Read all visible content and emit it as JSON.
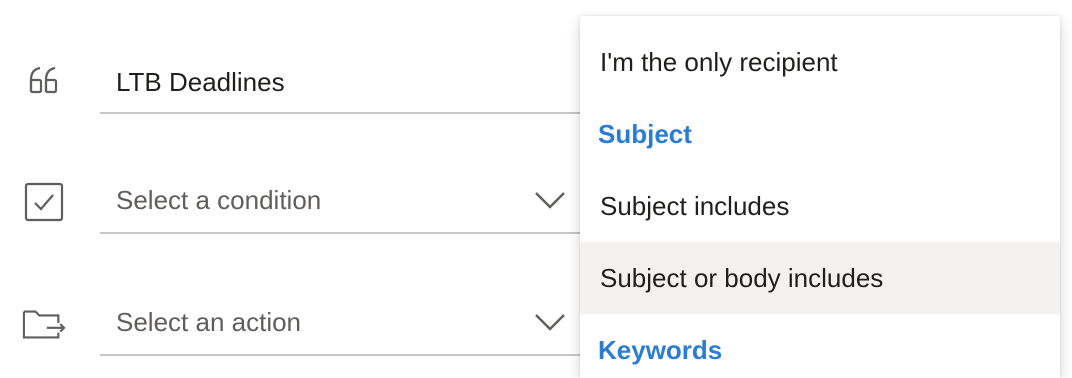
{
  "rule_name": {
    "value": "LTB Deadlines"
  },
  "condition": {
    "placeholder": "Select a condition"
  },
  "action": {
    "placeholder": "Select an action"
  },
  "icons": {
    "name_row": "quote-icon",
    "condition_row": "checkbox-icon",
    "action_row": "move-to-folder-icon",
    "dropdown": "chevron-down-icon"
  },
  "dropdown_menu": {
    "items": [
      {
        "type": "option",
        "label": "I'm the only recipient"
      },
      {
        "type": "header",
        "label": "Subject"
      },
      {
        "type": "option",
        "label": "Subject includes"
      },
      {
        "type": "option",
        "label": "Subject or body includes",
        "hovered": true
      },
      {
        "type": "header",
        "label": "Keywords"
      }
    ]
  },
  "colors": {
    "accent_header": "#2b7cd3",
    "hover_background": "#f3f2f1",
    "underline": "#c8c6c4",
    "text": "#201f1e",
    "placeholder": "#605e5c"
  }
}
